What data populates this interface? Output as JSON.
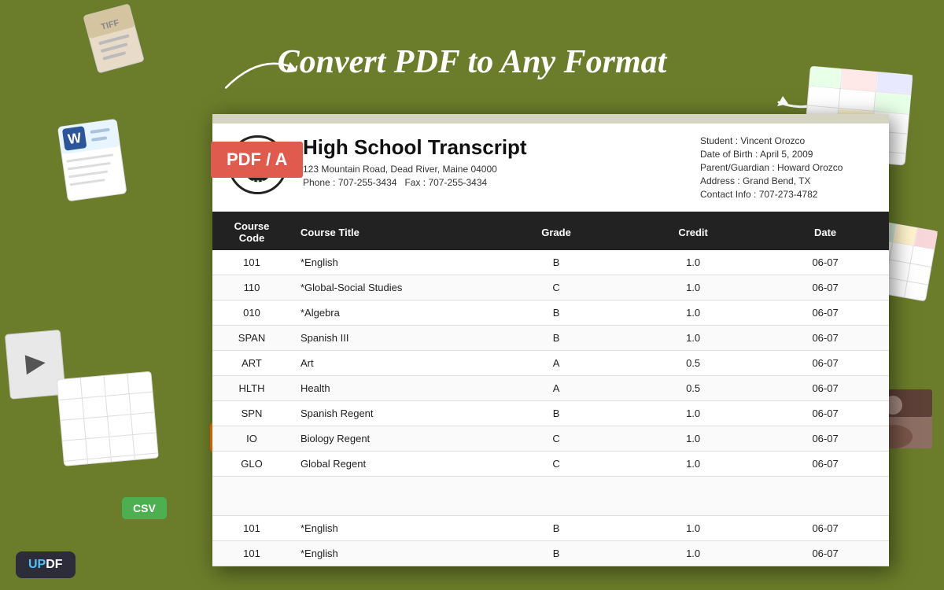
{
  "app": {
    "title": "UPDF",
    "tagline": "Convert PDF to Any Format"
  },
  "pdf_badge": "PDF / A",
  "document": {
    "title": "High School Transcript",
    "address": "123 Mountain Road, Dead River, Maine 04000",
    "phone": "Phone : 707-255-3434",
    "fax": "Fax : 707-255-3434",
    "student": "Student : Vincent Orozco",
    "dob": "Date of Birth : April 5,  2009",
    "guardian": "Parent/Guardian : Howard Orozco",
    "address_line": "Address : Grand Bend, TX",
    "contact": "Contact Info : 707-273-4782"
  },
  "table": {
    "headers": [
      "Course Code",
      "Course Title",
      "Grade",
      "Credit",
      "Date"
    ],
    "rows": [
      {
        "code": "101",
        "title": "*English",
        "grade": "B",
        "credit": "1.0",
        "date": "06-07"
      },
      {
        "code": "110",
        "title": "*Global-Social Studies",
        "grade": "C",
        "credit": "1.0",
        "date": "06-07"
      },
      {
        "code": "010",
        "title": "*Algebra",
        "grade": "B",
        "credit": "1.0",
        "date": "06-07"
      },
      {
        "code": "SPAN",
        "title": "Spanish III",
        "grade": "B",
        "credit": "1.0",
        "date": "06-07"
      },
      {
        "code": "ART",
        "title": "Art",
        "grade": "A",
        "credit": "0.5",
        "date": "06-07"
      },
      {
        "code": "HLTH",
        "title": "Health",
        "grade": "A",
        "credit": "0.5",
        "date": "06-07"
      },
      {
        "code": "SPN",
        "title": "Spanish Regent",
        "grade": "B",
        "credit": "1.0",
        "date": "06-07"
      },
      {
        "code": "IO",
        "title": "Biology Regent",
        "grade": "C",
        "credit": "1.0",
        "date": "06-07"
      },
      {
        "code": "GLO",
        "title": "Global Regent",
        "grade": "C",
        "credit": "1.0",
        "date": "06-07"
      },
      {
        "code": "101",
        "title": "*English",
        "grade": "B",
        "credit": "1.0",
        "date": "06-07"
      },
      {
        "code": "101",
        "title": "*English",
        "grade": "B",
        "credit": "1.0",
        "date": "06-07"
      }
    ]
  },
  "updf_label": "UPDF"
}
